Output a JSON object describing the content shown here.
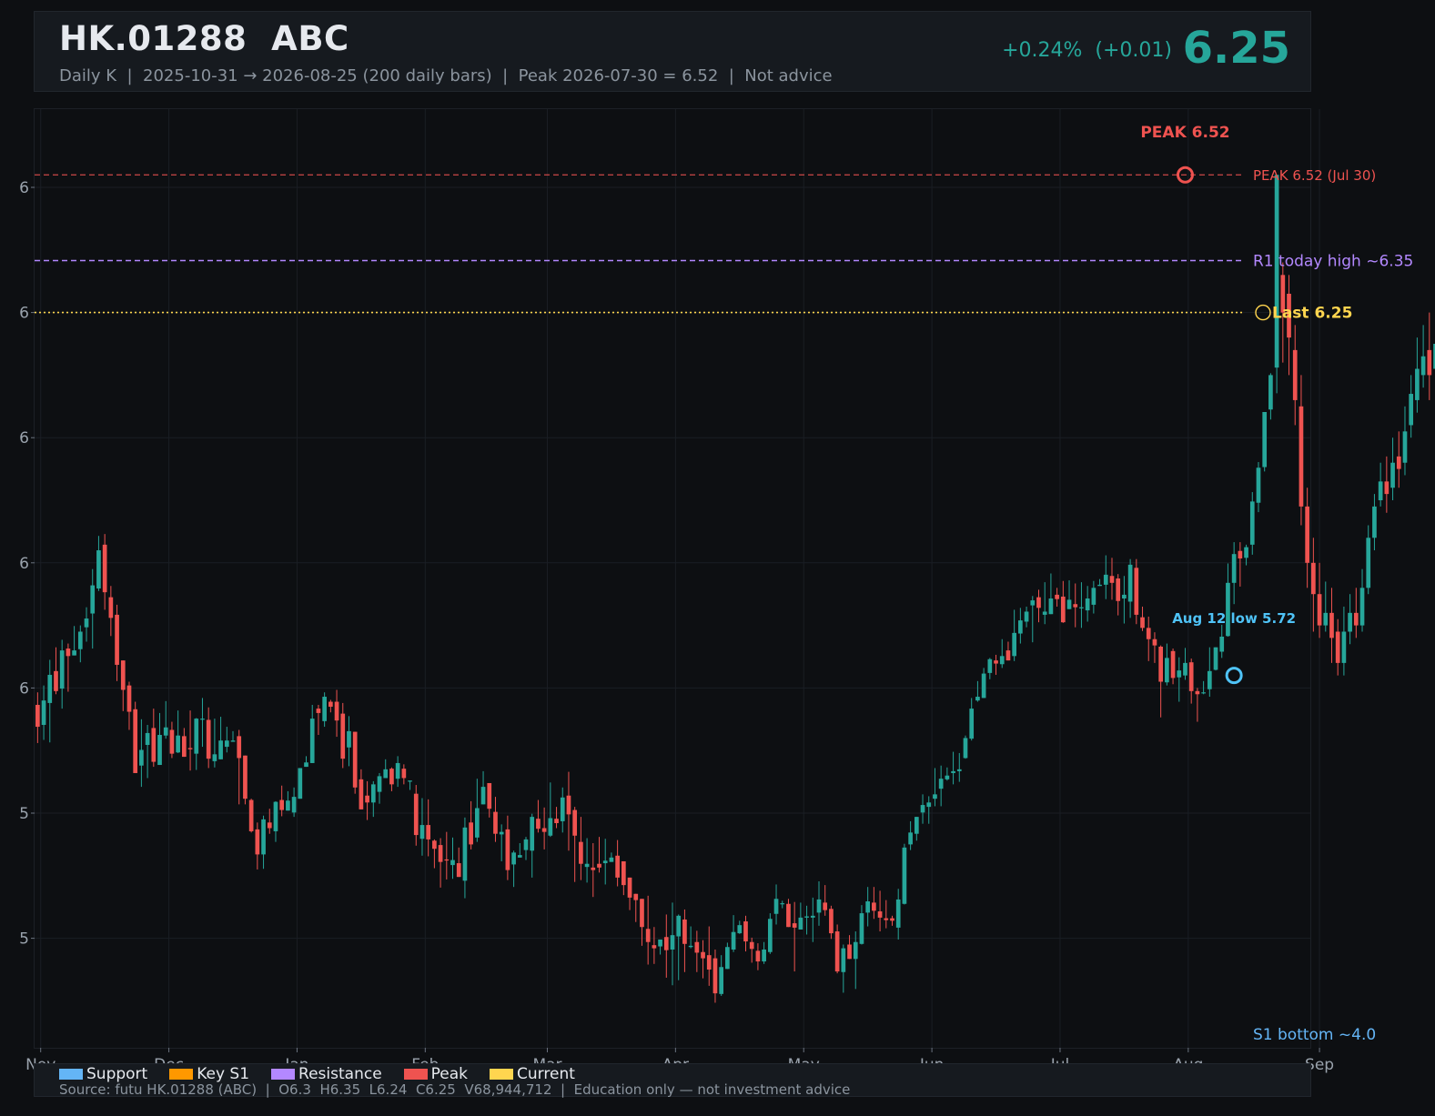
{
  "header": {
    "title": "HK.01288  ABC",
    "subtitle": "Daily K  |  2025-10-31 → 2026-08-25 (200 daily bars)  |  Peak 2026-07-30 = 6.52  |  Not advice",
    "change": "+0.24%  (+0.01)",
    "price": "6.25"
  },
  "footer": {
    "legend": [
      {
        "label": "Support",
        "color": "#64b5f6"
      },
      {
        "label": "Key S1",
        "color": "#ff9800"
      },
      {
        "label": "Resistance",
        "color": "#b388ff"
      },
      {
        "label": "Peak",
        "color": "#ef5350"
      },
      {
        "label": "Current",
        "color": "#ffd54f"
      }
    ],
    "source": "Source: futu HK.01288 (ABC)  |  O6.3  H6.35  L6.24  C6.25  V68,944,712  |  Education only — not investment advice"
  },
  "chart_data": {
    "type": "candlestick",
    "up_color": "#26a69a",
    "down_color": "#ef5350",
    "y_tick_labels": [
      "6",
      "6",
      "6",
      "6",
      "6",
      "5",
      "5"
    ],
    "y_tick_values": [
      6.5,
      6.3,
      6.1,
      5.9,
      5.7,
      5.5,
      5.3
    ],
    "ylim": [
      5.125,
      6.625
    ],
    "x_tick_labels": [
      "Nov",
      "Dec",
      "Jan",
      "Feb",
      "Mar",
      "Apr",
      "May",
      "Jun",
      "Jul",
      "Aug",
      "Sep"
    ],
    "xlim": [
      -0.5,
      208.5
    ],
    "x_tick_positions": [
      0.5,
      21.5,
      42.5,
      63.5,
      83.5,
      104.5,
      125.5,
      146.5,
      167.5,
      188.5,
      210
    ],
    "annotations": {
      "peak_line": {
        "value": 6.52,
        "label": "PEAK 6.52 (Jul 30)",
        "color": "#ef5350"
      },
      "peak_marker": {
        "index": 188,
        "value": 6.52,
        "label": "PEAK 6.52",
        "color": "#ef5350"
      },
      "resistance_line": {
        "value": 6.383,
        "label": "R1 today high ~6.35",
        "color": "#b388ff"
      },
      "current_line": {
        "value": 6.3,
        "label": "Last 6.25",
        "color": "#ffd54f"
      },
      "low_marker": {
        "index": 196,
        "value": 5.72,
        "label": "Aug 12 low 5.72",
        "color": "#4fc3f7"
      },
      "support_label": {
        "label": "S1 bottom ~4.0",
        "color": "#64b5f6"
      }
    },
    "candles": [
      [
        5.673,
        5.638,
        5.693,
        5.612
      ],
      [
        5.641,
        5.68,
        5.704,
        5.617
      ],
      [
        5.676,
        5.721,
        5.745,
        5.613
      ],
      [
        5.727,
        5.695,
        5.765,
        5.69
      ],
      [
        5.699,
        5.76,
        5.777,
        5.667
      ],
      [
        5.763,
        5.751,
        5.771,
        5.694
      ],
      [
        5.752,
        5.76,
        5.799,
        5.752
      ],
      [
        5.762,
        5.79,
        5.8,
        5.741
      ],
      [
        5.797,
        5.811,
        5.829,
        5.774
      ],
      [
        5.819,
        5.864,
        5.89,
        5.763
      ],
      [
        5.859,
        5.92,
        5.943,
        5.855
      ],
      [
        5.929,
        5.853,
        5.946,
        5.825
      ],
      [
        5.845,
        5.812,
        5.863,
        5.783
      ],
      [
        5.817,
        5.737,
        5.833,
        5.711
      ],
      [
        5.744,
        5.697,
        5.743,
        5.663
      ],
      [
        5.704,
        5.662,
        5.71,
        5.633
      ],
      [
        5.666,
        5.564,
        5.678,
        5.567
      ],
      [
        5.576,
        5.601,
        5.65,
        5.542
      ],
      [
        5.609,
        5.628,
        5.641,
        5.556
      ],
      [
        5.636,
        5.582,
        5.667,
        5.574
      ],
      [
        5.577,
        5.625,
        5.66,
        5.581
      ],
      [
        5.624,
        5.637,
        5.679,
        5.619
      ],
      [
        5.633,
        5.595,
        5.646,
        5.588
      ],
      [
        5.597,
        5.624,
        5.664,
        5.596
      ],
      [
        5.623,
        5.59,
        5.636,
        5.591
      ],
      [
        5.604,
        5.602,
        5.664,
        5.568
      ],
      [
        5.595,
        5.651,
        5.652,
        5.569
      ],
      [
        5.65,
        5.651,
        5.684,
        5.606
      ],
      [
        5.649,
        5.587,
        5.669,
        5.572
      ],
      [
        5.583,
        5.594,
        5.651,
        5.573
      ],
      [
        5.586,
        5.616,
        5.654,
        5.588
      ],
      [
        5.606,
        5.616,
        5.638,
        5.597
      ],
      [
        5.614,
        5.616,
        5.631,
        5.621
      ],
      [
        5.623,
        5.588,
        5.633,
        5.514
      ],
      [
        5.592,
        5.523,
        5.586,
        5.514
      ],
      [
        5.521,
        5.471,
        5.523,
        5.469
      ],
      [
        5.474,
        5.434,
        5.485,
        5.41
      ],
      [
        5.434,
        5.49,
        5.496,
        5.411
      ],
      [
        5.485,
        5.476,
        5.507,
        5.467
      ],
      [
        5.471,
        5.518,
        5.519,
        5.454
      ],
      [
        5.521,
        5.505,
        5.544,
        5.495
      ],
      [
        5.504,
        5.52,
        5.535,
        5.504
      ],
      [
        5.501,
        5.526,
        5.541,
        5.494
      ],
      [
        5.523,
        5.572,
        5.571,
        5.528
      ],
      [
        5.574,
        5.581,
        5.591,
        5.574
      ],
      [
        5.58,
        5.651,
        5.673,
        5.59
      ],
      [
        5.667,
        5.66,
        5.673,
        5.625
      ],
      [
        5.647,
        5.686,
        5.693,
        5.638
      ],
      [
        5.678,
        5.67,
        5.681,
        5.661
      ],
      [
        5.678,
        5.648,
        5.697,
        5.622
      ],
      [
        5.659,
        5.587,
        5.676,
        5.572
      ],
      [
        5.605,
        5.631,
        5.655,
        5.575
      ],
      [
        5.63,
        5.541,
        5.627,
        5.531
      ],
      [
        5.554,
        5.506,
        5.57,
        5.521
      ],
      [
        5.528,
        5.517,
        5.551,
        5.489
      ],
      [
        5.517,
        5.546,
        5.551,
        5.494
      ],
      [
        5.534,
        5.559,
        5.564,
        5.515
      ],
      [
        5.556,
        5.57,
        5.586,
        5.557
      ],
      [
        5.571,
        5.546,
        5.573,
        5.535
      ],
      [
        5.555,
        5.58,
        5.591,
        5.542
      ],
      [
        5.571,
        5.556,
        5.578,
        5.546
      ],
      [
        5.551,
        5.552,
        5.545,
        5.537
      ],
      [
        5.531,
        5.465,
        5.545,
        5.448
      ],
      [
        5.459,
        5.481,
        5.524,
        5.432
      ],
      [
        5.481,
        5.458,
        5.522,
        5.431
      ],
      [
        5.456,
        5.443,
        5.458,
        5.412
      ],
      [
        5.449,
        5.422,
        5.46,
        5.381
      ],
      [
        5.426,
        5.425,
        5.47,
        5.394
      ],
      [
        5.417,
        5.425,
        5.461,
        5.395
      ],
      [
        5.42,
        5.398,
        5.445,
        5.405
      ],
      [
        5.392,
        5.477,
        5.493,
        5.364
      ],
      [
        5.485,
        5.45,
        5.519,
        5.442
      ],
      [
        5.461,
        5.508,
        5.555,
        5.454
      ],
      [
        5.514,
        5.542,
        5.567,
        5.524
      ],
      [
        5.548,
        5.507,
        5.534,
        5.493
      ],
      [
        5.502,
        5.467,
        5.526,
        5.454
      ],
      [
        5.466,
        5.47,
        5.482,
        5.423
      ],
      [
        5.474,
        5.409,
        5.496,
        5.393
      ],
      [
        5.418,
        5.437,
        5.44,
        5.382
      ],
      [
        5.429,
        5.433,
        5.452,
        5.432
      ],
      [
        5.441,
        5.458,
        5.462,
        5.425
      ],
      [
        5.44,
        5.494,
        5.499,
        5.397
      ],
      [
        5.491,
        5.475,
        5.521,
        5.469
      ],
      [
        5.476,
        5.47,
        5.509,
        5.442
      ],
      [
        5.464,
        5.492,
        5.549,
        5.462
      ],
      [
        5.491,
        5.484,
        5.51,
        5.476
      ],
      [
        5.487,
        5.525,
        5.541,
        5.469
      ],
      [
        5.528,
        5.498,
        5.566,
        5.44
      ],
      [
        5.505,
        5.464,
        5.51,
        5.39
      ],
      [
        5.454,
        5.419,
        5.494,
        5.393
      ],
      [
        5.414,
        5.419,
        5.46,
        5.389
      ],
      [
        5.413,
        5.409,
        5.452,
        5.366
      ],
      [
        5.419,
        5.413,
        5.462,
        5.405
      ],
      [
        5.42,
        5.424,
        5.459,
        5.386
      ],
      [
        5.422,
        5.429,
        5.437,
        5.425
      ],
      [
        5.432,
        5.397,
        5.457,
        5.383
      ],
      [
        5.423,
        5.385,
        5.418,
        5.369
      ],
      [
        5.397,
        5.365,
        5.383,
        5.345
      ],
      [
        5.371,
        5.361,
        5.363,
        5.326
      ],
      [
        5.363,
        5.318,
        5.354,
        5.288
      ],
      [
        5.315,
        5.294,
        5.368,
        5.258
      ],
      [
        5.289,
        5.284,
        5.318,
        5.259
      ],
      [
        5.287,
        5.298,
        5.298,
        5.274
      ],
      [
        5.302,
        5.281,
        5.338,
        5.237
      ],
      [
        5.282,
        5.305,
        5.357,
        5.225
      ],
      [
        5.303,
        5.336,
        5.338,
        5.233
      ],
      [
        5.33,
        5.291,
        5.346,
        5.246
      ],
      [
        5.286,
        5.288,
        5.319,
        5.284
      ],
      [
        5.294,
        5.277,
        5.312,
        5.246
      ],
      [
        5.278,
        5.268,
        5.297,
        5.236
      ],
      [
        5.273,
        5.25,
        5.319,
        5.224
      ],
      [
        5.268,
        5.212,
        5.282,
        5.197
      ],
      [
        5.211,
        5.254,
        5.273,
        5.208
      ],
      [
        5.251,
        5.286,
        5.293,
        5.257
      ],
      [
        5.282,
        5.31,
        5.337,
        5.278
      ],
      [
        5.308,
        5.321,
        5.328,
        5.307
      ],
      [
        5.327,
        5.295,
        5.336,
        5.279
      ],
      [
        5.294,
        5.283,
        5.301,
        5.261
      ],
      [
        5.28,
        5.263,
        5.292,
        5.249
      ],
      [
        5.263,
        5.282,
        5.294,
        5.259
      ],
      [
        5.278,
        5.331,
        5.34,
        5.275
      ],
      [
        5.339,
        5.363,
        5.386,
        5.322
      ],
      [
        5.355,
        5.356,
        5.36,
        5.348
      ],
      [
        5.355,
        5.318,
        5.363,
        5.331
      ],
      [
        5.324,
        5.317,
        5.358,
        5.247
      ],
      [
        5.314,
        5.333,
        5.357,
        5.318
      ],
      [
        5.333,
        5.335,
        5.352,
        5.306
      ],
      [
        5.333,
        5.336,
        5.365,
        5.294
      ],
      [
        5.341,
        5.362,
        5.391,
        5.32
      ],
      [
        5.357,
        5.345,
        5.385,
        5.336
      ],
      [
        5.347,
        5.308,
        5.352,
        5.299
      ],
      [
        5.311,
        5.247,
        5.322,
        5.244
      ],
      [
        5.246,
        5.284,
        5.29,
        5.213
      ],
      [
        5.29,
        5.267,
        5.305,
        5.267
      ],
      [
        5.267,
        5.294,
        5.311,
        5.219
      ],
      [
        5.291,
        5.34,
        5.353,
        5.29
      ],
      [
        5.341,
        5.359,
        5.382,
        5.319
      ],
      [
        5.357,
        5.344,
        5.382,
        5.331
      ],
      [
        5.343,
        5.333,
        5.376,
        5.311
      ],
      [
        5.332,
        5.329,
        5.361,
        5.316
      ],
      [
        5.332,
        5.328,
        5.336,
        5.32
      ],
      [
        5.317,
        5.362,
        5.379,
        5.298
      ],
      [
        5.355,
        5.445,
        5.451,
        5.354
      ],
      [
        5.45,
        5.469,
        5.487,
        5.441
      ],
      [
        5.467,
        5.494,
        5.494,
        5.456
      ],
      [
        5.501,
        5.513,
        5.53,
        5.483
      ],
      [
        5.51,
        5.517,
        5.527,
        5.483
      ],
      [
        5.523,
        5.53,
        5.572,
        5.511
      ],
      [
        5.539,
        5.555,
        5.576,
        5.511
      ],
      [
        5.554,
        5.56,
        5.573,
        5.552
      ],
      [
        5.564,
        5.567,
        5.598,
        5.546
      ],
      [
        5.567,
        5.57,
        5.596,
        5.55
      ],
      [
        5.588,
        5.62,
        5.624,
        5.587
      ],
      [
        5.619,
        5.667,
        5.684,
        5.616
      ],
      [
        5.68,
        5.686,
        5.711,
        5.678
      ],
      [
        5.684,
        5.723,
        5.732,
        5.684
      ],
      [
        5.724,
        5.746,
        5.748,
        5.714
      ],
      [
        5.744,
        5.739,
        5.753,
        5.721
      ],
      [
        5.738,
        5.751,
        5.778,
        5.732
      ],
      [
        5.76,
        5.744,
        5.774,
        5.744
      ],
      [
        5.751,
        5.788,
        5.825,
        5.743
      ],
      [
        5.787,
        5.808,
        5.828,
        5.771
      ],
      [
        5.806,
        5.822,
        5.83,
        5.797
      ],
      [
        5.832,
        5.84,
        5.847,
        5.773
      ],
      [
        5.845,
        5.828,
        5.857,
        5.805
      ],
      [
        5.817,
        5.822,
        5.869,
        5.802
      ],
      [
        5.818,
        5.843,
        5.883,
        5.818
      ],
      [
        5.849,
        5.842,
        5.86,
        5.83
      ],
      [
        5.846,
        5.805,
        5.871,
        5.804
      ],
      [
        5.826,
        5.841,
        5.872,
        5.826
      ],
      [
        5.834,
        5.829,
        5.867,
        5.797
      ],
      [
        5.829,
        5.829,
        5.869,
        5.796
      ],
      [
        5.824,
        5.843,
        5.863,
        5.806
      ],
      [
        5.833,
        5.86,
        5.871,
        5.819
      ],
      [
        5.863,
        5.865,
        5.874,
        5.864
      ],
      [
        5.865,
        5.881,
        5.912,
        5.842
      ],
      [
        5.879,
        5.868,
        5.908,
        5.841
      ],
      [
        5.875,
        5.839,
        5.882,
        5.816
      ],
      [
        5.843,
        5.849,
        5.879,
        5.803
      ],
      [
        5.838,
        5.897,
        5.906,
        5.812
      ],
      [
        5.892,
        5.817,
        5.906,
        5.802
      ],
      [
        5.813,
        5.796,
        5.83,
        5.791
      ],
      [
        5.796,
        5.778,
        5.814,
        5.743
      ],
      [
        5.778,
        5.768,
        5.789,
        5.74
      ],
      [
        5.766,
        5.71,
        5.768,
        5.653
      ],
      [
        5.709,
        5.748,
        5.771,
        5.704
      ],
      [
        5.759,
        5.716,
        5.763,
        5.706
      ],
      [
        5.717,
        5.728,
        5.749,
        5.678
      ],
      [
        5.72,
        5.74,
        5.764,
        5.713
      ],
      [
        5.741,
        5.695,
        5.747,
        5.675
      ],
      [
        5.695,
        5.69,
        5.7,
        5.646
      ],
      [
        5.692,
        5.693,
        5.711,
        5.69
      ],
      [
        5.698,
        5.727,
        5.765,
        5.686
      ],
      [
        5.729,
        5.765,
        5.76,
        5.728
      ],
      [
        5.758,
        5.782,
        5.801,
        5.748
      ],
      [
        5.783,
        5.868,
        5.899,
        5.782
      ],
      [
        5.868,
        5.914,
        5.933,
        5.834
      ],
      [
        5.919,
        5.907,
        5.933,
        5.862
      ],
      [
        5.908,
        5.925,
        5.929,
        5.896
      ],
      [
        5.929,
        5.998,
        6.013,
        5.913
      ],
      [
        5.996,
        6.052,
        6.061,
        5.981
      ],
      [
        6.053,
        6.141,
        6.133,
        6.046
      ],
      [
        6.145,
        6.2,
        6.203,
        6.129
      ],
      [
        6.212,
        6.52,
        6.52,
        6.171
      ],
      [
        6.36,
        6.3,
        6.38,
        6.22
      ],
      [
        6.33,
        6.26,
        6.36,
        6.2
      ],
      [
        6.24,
        6.16,
        6.28,
        6.12
      ],
      [
        6.15,
        5.99,
        6.2,
        5.96
      ],
      [
        5.99,
        5.9,
        6.02,
        5.86
      ],
      [
        5.9,
        5.85,
        5.94,
        5.79
      ],
      [
        5.85,
        5.8,
        5.9,
        5.78
      ],
      [
        5.8,
        5.82,
        5.87,
        5.79
      ],
      [
        5.82,
        5.78,
        5.86,
        5.74
      ],
      [
        5.79,
        5.74,
        5.81,
        5.72
      ],
      [
        5.74,
        5.79,
        5.83,
        5.72
      ],
      [
        5.79,
        5.82,
        5.85,
        5.77
      ],
      [
        5.82,
        5.8,
        5.86,
        5.78
      ],
      [
        5.8,
        5.86,
        5.89,
        5.79
      ],
      [
        5.86,
        5.94,
        5.96,
        5.85
      ],
      [
        5.94,
        5.99,
        6.01,
        5.92
      ],
      [
        6.0,
        6.03,
        6.06,
        5.99
      ],
      [
        6.03,
        6.01,
        6.07,
        5.98
      ],
      [
        6.02,
        6.06,
        6.1,
        6.0
      ],
      [
        6.07,
        6.05,
        6.11,
        6.02
      ],
      [
        6.06,
        6.11,
        6.15,
        6.04
      ],
      [
        6.12,
        6.17,
        6.2,
        6.1
      ],
      [
        6.16,
        6.21,
        6.26,
        6.14
      ],
      [
        6.2,
        6.23,
        6.28,
        6.18
      ],
      [
        6.24,
        6.2,
        6.3,
        6.16
      ],
      [
        6.21,
        6.25,
        6.29,
        6.19
      ],
      [
        6.3,
        6.25,
        6.35,
        6.24
      ]
    ]
  }
}
